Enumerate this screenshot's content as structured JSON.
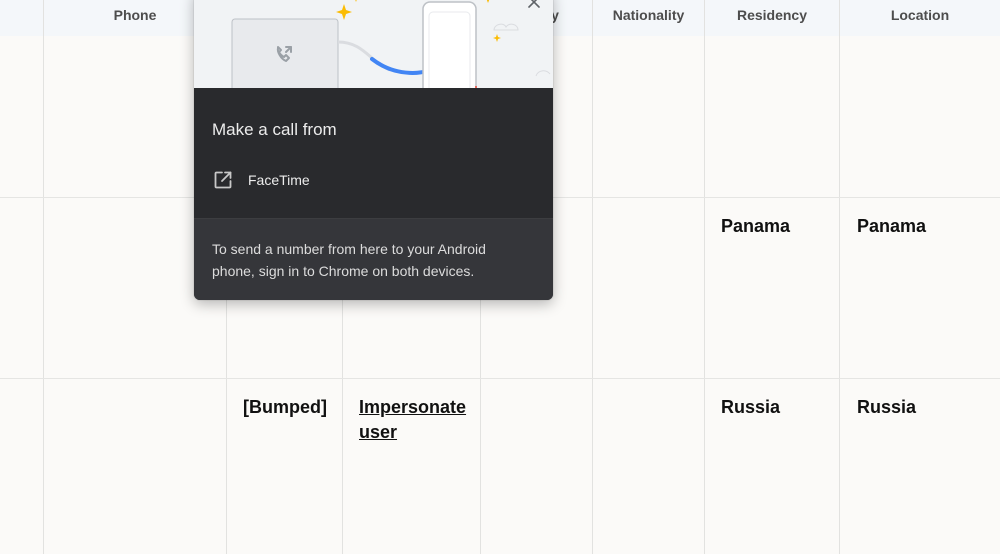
{
  "table": {
    "headers": {
      "phone": "Phone",
      "partial": "y",
      "nationality": "Nationality",
      "residency": "Residency",
      "location": "Location"
    },
    "rows": [
      {
        "residency": "",
        "location": ""
      },
      {
        "residency": "Panama",
        "location": "Panama"
      },
      {
        "status": "[Bumped]",
        "action": "Impersonate user",
        "residency": "Russia",
        "location": "Russia"
      }
    ]
  },
  "popup": {
    "title": "Make a call from",
    "option_label": "FaceTime",
    "footer_text": "To send a number from here to your Android phone, sign in to Chrome on both devices.",
    "icons": {
      "close": "close-icon",
      "option": "open-external-icon",
      "illustration": "laptop-phone-call-illustration"
    },
    "colors": {
      "background": "#292a2d",
      "footer": "#35363a",
      "accent": "#4285f4",
      "sparkle": "#fbbc04"
    }
  }
}
